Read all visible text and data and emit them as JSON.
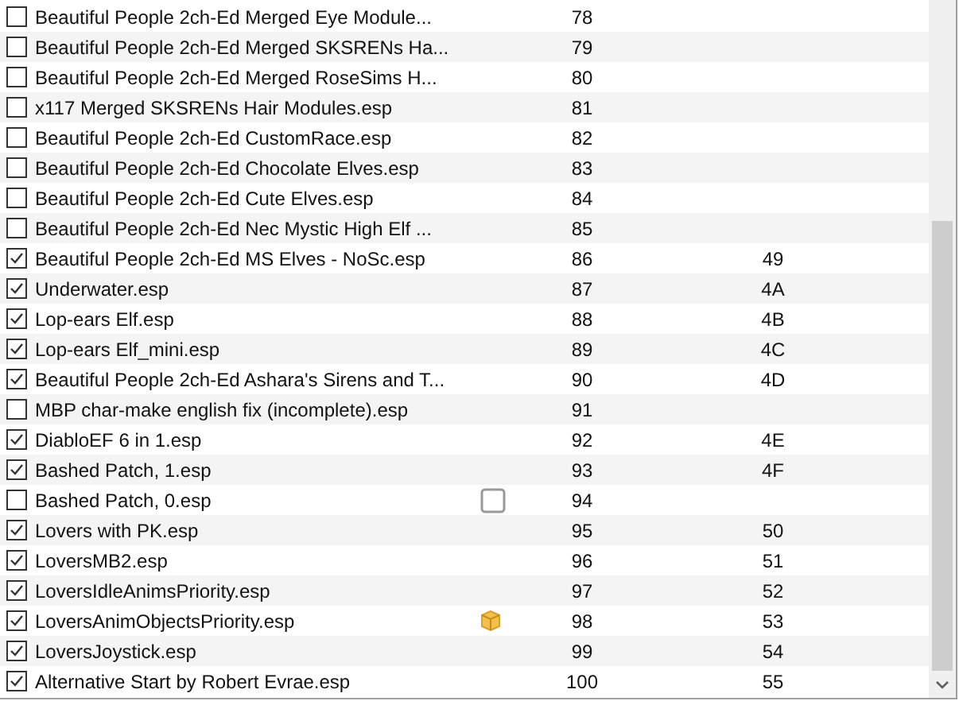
{
  "plugins": [
    {
      "name": "Beautiful People 2ch-Ed Merged Eye Module...",
      "checked": false,
      "order": "78"
    },
    {
      "name": "Beautiful People 2ch-Ed Merged SKSRENs Ha...",
      "checked": false,
      "order": "79"
    },
    {
      "name": "Beautiful People 2ch-Ed Merged RoseSims H...",
      "checked": false,
      "order": "80"
    },
    {
      "name": "x117 Merged SKSRENs Hair Modules.esp",
      "checked": false,
      "order": "81"
    },
    {
      "name": "Beautiful People 2ch-Ed CustomRace.esp",
      "checked": false,
      "order": "82"
    },
    {
      "name": "Beautiful People 2ch-Ed Chocolate Elves.esp",
      "checked": false,
      "order": "83"
    },
    {
      "name": "Beautiful People 2ch-Ed Cute Elves.esp",
      "checked": false,
      "order": "84"
    },
    {
      "name": "Beautiful People 2ch-Ed Nec Mystic High Elf ...",
      "checked": false,
      "order": "85"
    },
    {
      "name": "Beautiful People 2ch-Ed MS Elves - NoSc.esp",
      "checked": true,
      "order": "86",
      "index": "49"
    },
    {
      "name": "Underwater.esp",
      "checked": true,
      "order": "87",
      "index": "4A"
    },
    {
      "name": "Lop-ears Elf.esp",
      "checked": true,
      "order": "88",
      "index": "4B"
    },
    {
      "name": "Lop-ears Elf_mini.esp",
      "checked": true,
      "order": "89",
      "index": "4C"
    },
    {
      "name": "Beautiful People 2ch-Ed Ashara's Sirens and T...",
      "checked": true,
      "order": "90",
      "index": "4D"
    },
    {
      "name": "MBP char-make english fix (incomplete).esp",
      "checked": false,
      "order": "91"
    },
    {
      "name": "DiabloEF 6 in 1.esp",
      "checked": true,
      "order": "92",
      "index": "4E"
    },
    {
      "name": "Bashed Patch, 1.esp",
      "checked": true,
      "order": "93",
      "index": "4F"
    },
    {
      "name": "Bashed Patch, 0.esp",
      "checked": false,
      "order": "94",
      "kind": "ghost"
    },
    {
      "name": "Lovers with PK.esp",
      "checked": true,
      "order": "95",
      "index": "50"
    },
    {
      "name": "LoversMB2.esp",
      "checked": true,
      "order": "96",
      "index": "51"
    },
    {
      "name": "LoversIdleAnimsPriority.esp",
      "checked": true,
      "order": "97",
      "index": "52"
    },
    {
      "name": "LoversAnimObjectsPriority.esp",
      "checked": true,
      "order": "98",
      "index": "53",
      "kind": "bundled"
    },
    {
      "name": "LoversJoystick.esp",
      "checked": true,
      "order": "99",
      "index": "54"
    },
    {
      "name": "Alternative Start by Robert Evrae.esp",
      "checked": true,
      "order": "100",
      "index": "55"
    }
  ]
}
